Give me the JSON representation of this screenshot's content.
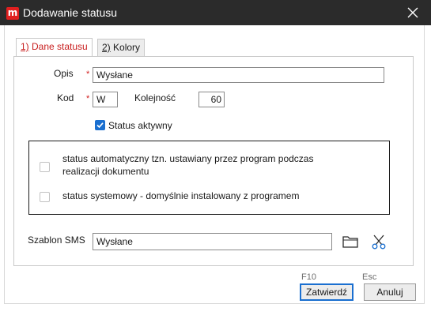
{
  "window": {
    "title": "Dodawanie statusu",
    "app_icon_letter": "m"
  },
  "tabs": [
    {
      "label": "Dane statusu",
      "hotkey": "1)",
      "active": true
    },
    {
      "label": "Kolory",
      "hotkey": "2)",
      "active": false
    }
  ],
  "form": {
    "opis_label": "Opis",
    "opis_value": "Wysłane",
    "kod_label": "Kod",
    "kod_value": "W",
    "kolejnosc_label": "Kolejność",
    "kolejnosc_value": "60",
    "required_mark": "*",
    "status_aktywny_label": "Status aktywny",
    "status_aktywny_checked": true,
    "auto_status_label_line1": "status automatyczny tzn. ustawiany przez program podczas",
    "auto_status_label_line2": "realizacji dokumentu",
    "auto_status_checked": false,
    "system_status_label": "status systemowy - domyślnie instalowany z programem",
    "system_status_checked": false,
    "szablon_sms_label": "Szablon SMS",
    "szablon_sms_value": "Wysłane"
  },
  "footer": {
    "confirm_shortcut": "F10",
    "confirm_label": "Zatwierdź",
    "cancel_shortcut": "Esc",
    "cancel_label": "Anuluj"
  },
  "colors": {
    "titlebar": "#2b2b2b",
    "accent_blue": "#1a6fd0",
    "required_red": "#d21f1f",
    "active_tab_text": "#c81e1e"
  },
  "icons": [
    "close-icon",
    "folder-icon",
    "scissors-icon",
    "checkmark-icon"
  ]
}
